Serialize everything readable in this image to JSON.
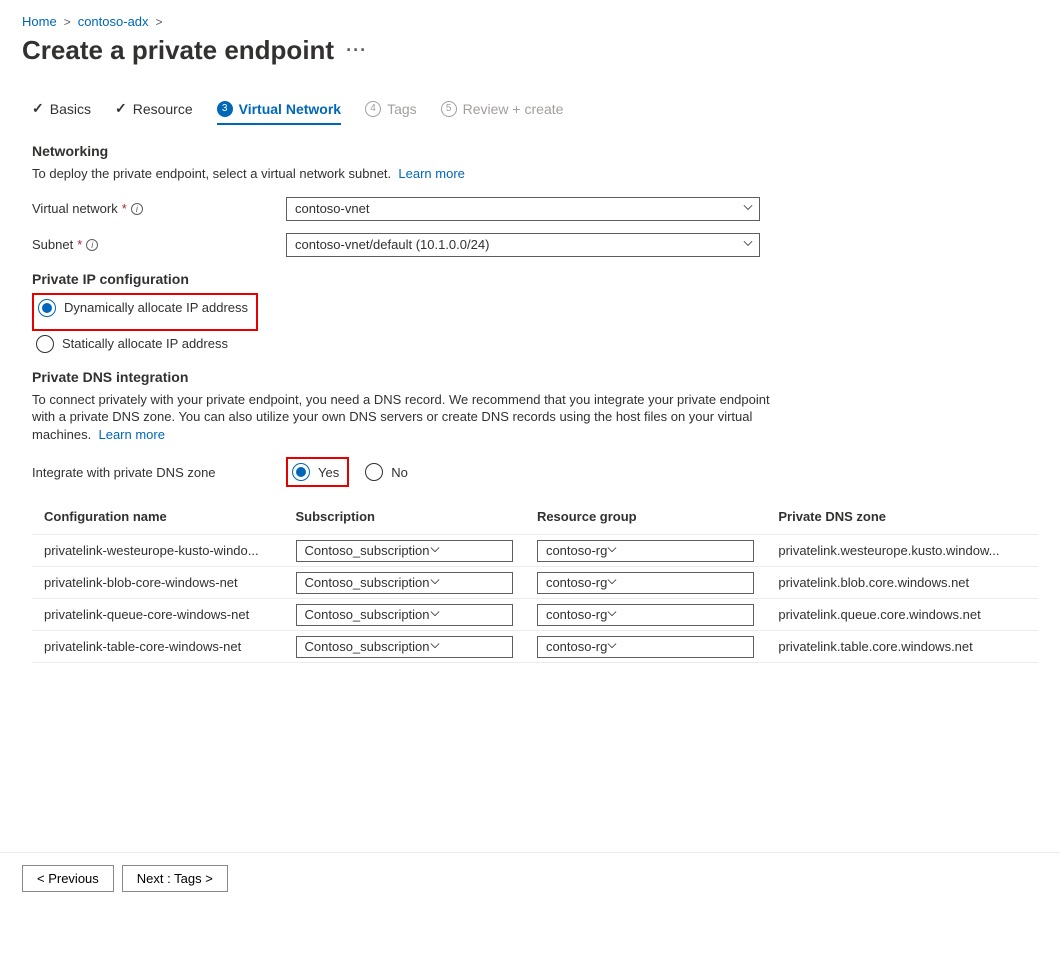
{
  "breadcrumb": {
    "items": [
      {
        "label": "Home"
      },
      {
        "label": "contoso-adx"
      }
    ]
  },
  "page": {
    "title": "Create a private endpoint"
  },
  "tabs": {
    "t0": {
      "label": "Basics"
    },
    "t1": {
      "label": "Resource"
    },
    "t2": {
      "label": "Virtual Network",
      "num": "3"
    },
    "t3": {
      "label": "Tags",
      "num": "4"
    },
    "t4": {
      "label": "Review + create",
      "num": "5"
    }
  },
  "networking": {
    "title": "Networking",
    "desc": "To deploy the private endpoint, select a virtual network subnet.",
    "learn_more": "Learn more",
    "vnet_label": "Virtual network",
    "vnet_value": "contoso-vnet",
    "subnet_label": "Subnet",
    "subnet_value": "contoso-vnet/default (10.1.0.0/24)"
  },
  "ip_config": {
    "title": "Private IP configuration",
    "opt_dynamic": "Dynamically allocate IP address",
    "opt_static": "Statically allocate IP address"
  },
  "dns": {
    "title": "Private DNS integration",
    "desc": "To connect privately with your private endpoint, you need a DNS record. We recommend that you integrate your private endpoint with a private DNS zone. You can also utilize your own DNS servers or create DNS records using the host files on your virtual machines.",
    "learn_more": "Learn more",
    "integrate_label": "Integrate with private DNS zone",
    "opt_yes": "Yes",
    "opt_no": "No",
    "headers": {
      "h0": "Configuration name",
      "h1": "Subscription",
      "h2": "Resource group",
      "h3": "Private DNS zone"
    },
    "rows": [
      {
        "name": "privatelink-westeurope-kusto-windo...",
        "sub": "Contoso_subscription",
        "rg": "contoso-rg",
        "zone": "privatelink.westeurope.kusto.window..."
      },
      {
        "name": "privatelink-blob-core-windows-net",
        "sub": "Contoso_subscription",
        "rg": "contoso-rg",
        "zone": "privatelink.blob.core.windows.net"
      },
      {
        "name": "privatelink-queue-core-windows-net",
        "sub": "Contoso_subscription",
        "rg": "contoso-rg",
        "zone": "privatelink.queue.core.windows.net"
      },
      {
        "name": "privatelink-table-core-windows-net",
        "sub": "Contoso_subscription",
        "rg": "contoso-rg",
        "zone": "privatelink.table.core.windows.net"
      }
    ]
  },
  "footer": {
    "prev": "< Previous",
    "next": "Next : Tags >"
  }
}
